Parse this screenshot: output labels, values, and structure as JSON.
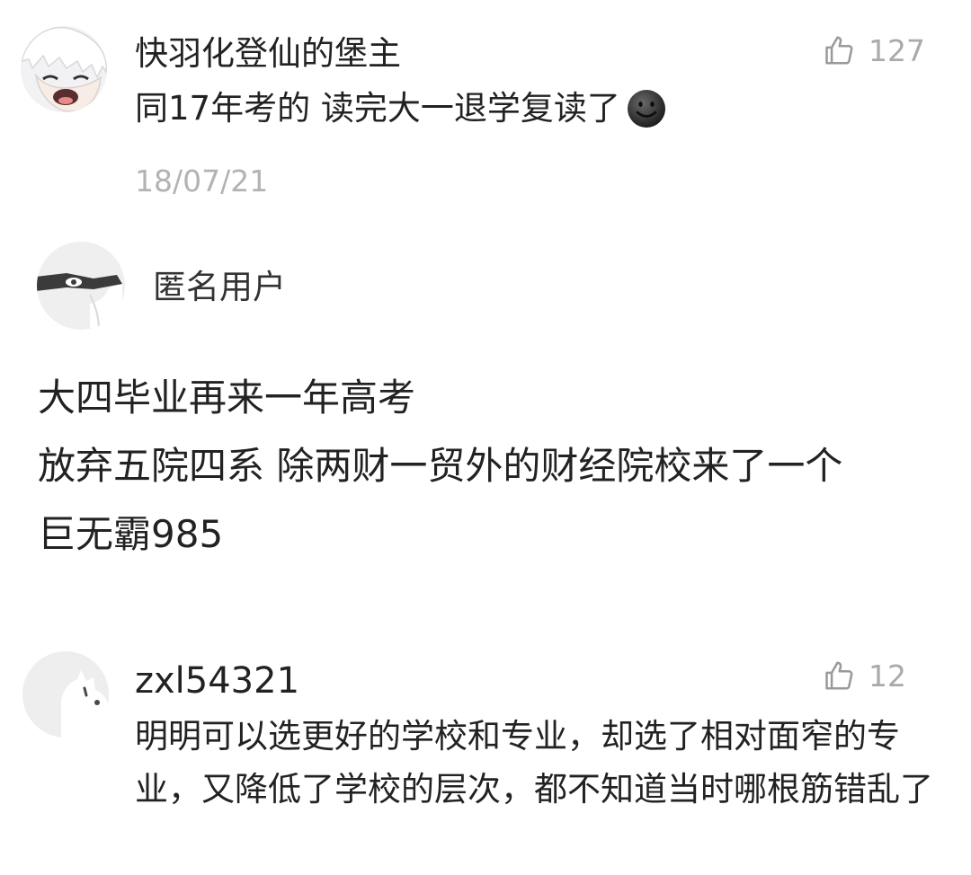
{
  "comments": [
    {
      "username": "快羽化登仙的堡主",
      "likes": "127",
      "text": "同17年考的 读完大一退学复读了",
      "emoji": "dark-smiley-emoji",
      "date": "18/07/21"
    },
    {
      "username": "匿名用户",
      "lines": [
        "大四毕业再来一年高考",
        "放弃五院四系 除两财一贸外的财经院校来了一个",
        "巨无霸985"
      ]
    },
    {
      "username": "zxl54321",
      "likes": "12",
      "text": "明明可以选更好的学校和专业，却选了相对面窄的专业，又降低了学校的层次，都不知道当时哪根筋错乱了"
    }
  ],
  "colors": {
    "text": "#222222",
    "meta": "#aaaaaa",
    "date": "#b3b3b3",
    "background": "#ffffff"
  },
  "icons": {
    "like": "thumbs-up-icon",
    "avatar_default": "default-dog-avatar-icon"
  }
}
